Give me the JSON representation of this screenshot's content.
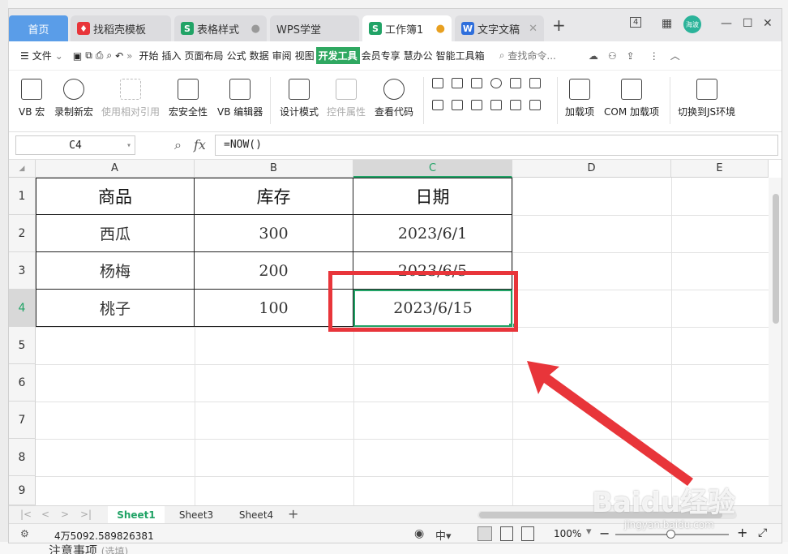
{
  "tabs": {
    "home": "首页",
    "t1": "找稻壳模板",
    "t2": "表格样式",
    "t3": "WPS学堂",
    "t4": "工作簿1",
    "t5": "文字文稿"
  },
  "window": {
    "badge": "4",
    "avatar": "海波"
  },
  "menu": {
    "file": "文件",
    "items": [
      "开始",
      "插入",
      "页面布局",
      "公式",
      "数据",
      "审阅",
      "视图"
    ],
    "active": "开发工具",
    "items2": [
      "会员专享",
      "慧办公",
      "智能工具箱"
    ],
    "search": "查找命令..."
  },
  "ribbon": {
    "vb_macro": "VB 宏",
    "record_macro": "录制新宏",
    "relative_ref": "使用相对引用",
    "macro_security": "宏安全性",
    "vb_editor": "VB 编辑器",
    "design_mode": "设计模式",
    "control_props": "控件属性",
    "view_code": "查看代码",
    "addins": "加载项",
    "com_addins": "COM 加载项",
    "js_env": "切换到JS环境"
  },
  "formula": {
    "namebox": "C4",
    "fx": "fx",
    "content": "=NOW()"
  },
  "grid": {
    "columns": [
      "A",
      "B",
      "C",
      "D",
      "E"
    ],
    "rows": [
      "1",
      "2",
      "3",
      "4",
      "5",
      "6",
      "7",
      "8",
      "9"
    ],
    "headers": [
      "商品",
      "库存",
      "日期"
    ],
    "data": [
      [
        "西瓜",
        "300",
        "2023/6/1"
      ],
      [
        "杨梅",
        "200",
        "2023/6/5"
      ],
      [
        "桃子",
        "100",
        "2023/6/15"
      ]
    ]
  },
  "sheets": [
    "Sheet1",
    "Sheet3",
    "Sheet4"
  ],
  "status": {
    "value": "4万5092.589826381",
    "zoom": "100%"
  },
  "watermark": {
    "main": "Baidu经验",
    "sub": "jingyan.baidu.com"
  },
  "background_note": {
    "text": "注意事项",
    "sub": "(选填)"
  },
  "colors": {
    "accent": "#2fa861",
    "highlight": "#e8353a",
    "tab_blue": "#5a9de8"
  }
}
